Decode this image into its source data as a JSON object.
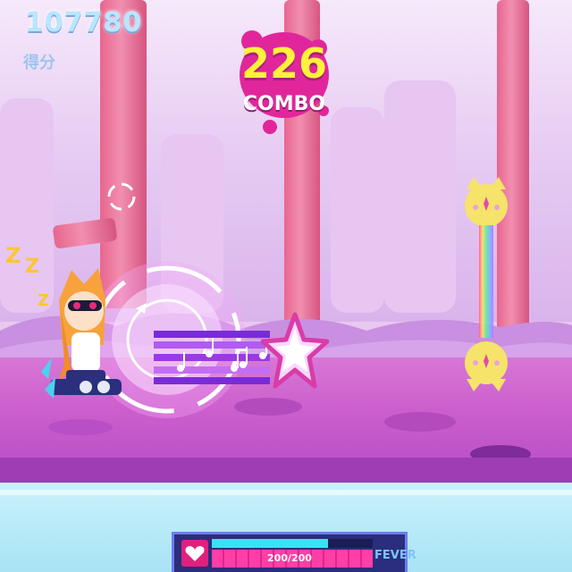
{
  "hud": {
    "score_value": "107780",
    "score_label": "得分",
    "combo_count": "226",
    "combo_label": "COMBO",
    "hp_text": "200/200",
    "fever_label": "FEVER",
    "hp_fraction": 1.0,
    "fever_fraction": 0.72
  },
  "notes": {
    "sleep_glyphs": [
      "Z",
      "Z",
      "Z"
    ]
  },
  "colors": {
    "score": "#b9e6ff",
    "combo_number": "#fff23a",
    "combo_splat": "#e1269b",
    "ground": "#cc5fcd",
    "water": "#a9e3f5",
    "trunk": "#ec7aa0"
  },
  "icons": {
    "heart": "heart-icon",
    "target": "target-reticle-icon",
    "music_note": "music-note-icon",
    "star": "star-note-icon",
    "cat_enemy": "cat-head-icon"
  }
}
